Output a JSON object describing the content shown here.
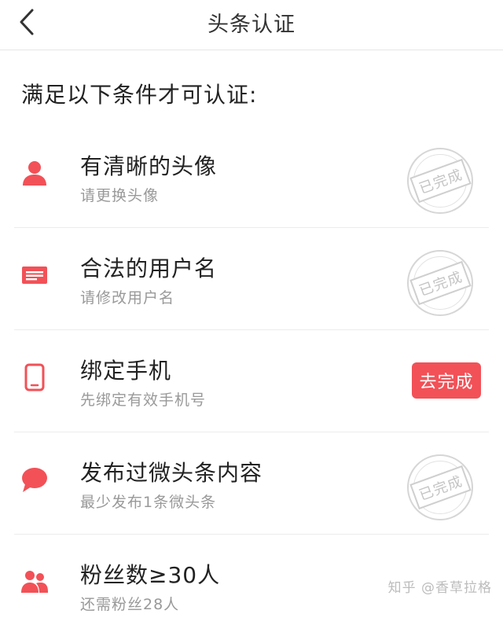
{
  "navbar": {
    "title": "头条认证"
  },
  "intro": {
    "text": "满足以下条件才可认证:"
  },
  "colors": {
    "accent": "#f25157",
    "stamp": "#c4c4c4"
  },
  "conditions": [
    {
      "icon": "person-icon",
      "title": "有清晰的头像",
      "subtitle": "请更换头像",
      "status": "已完成"
    },
    {
      "icon": "id-card-icon",
      "title": "合法的用户名",
      "subtitle": "请修改用户名",
      "status": "已完成"
    },
    {
      "icon": "phone-icon",
      "title": "绑定手机",
      "subtitle": "先绑定有效手机号",
      "action": "去完成"
    },
    {
      "icon": "speech-bubble-icon",
      "title": "发布过微头条内容",
      "subtitle": "最少发布1条微头条",
      "status": "已完成"
    },
    {
      "icon": "people-icon",
      "title": "粉丝数≥30人",
      "subtitle": "还需粉丝28人"
    }
  ],
  "watermark": {
    "text": "知乎 @香草拉格"
  }
}
